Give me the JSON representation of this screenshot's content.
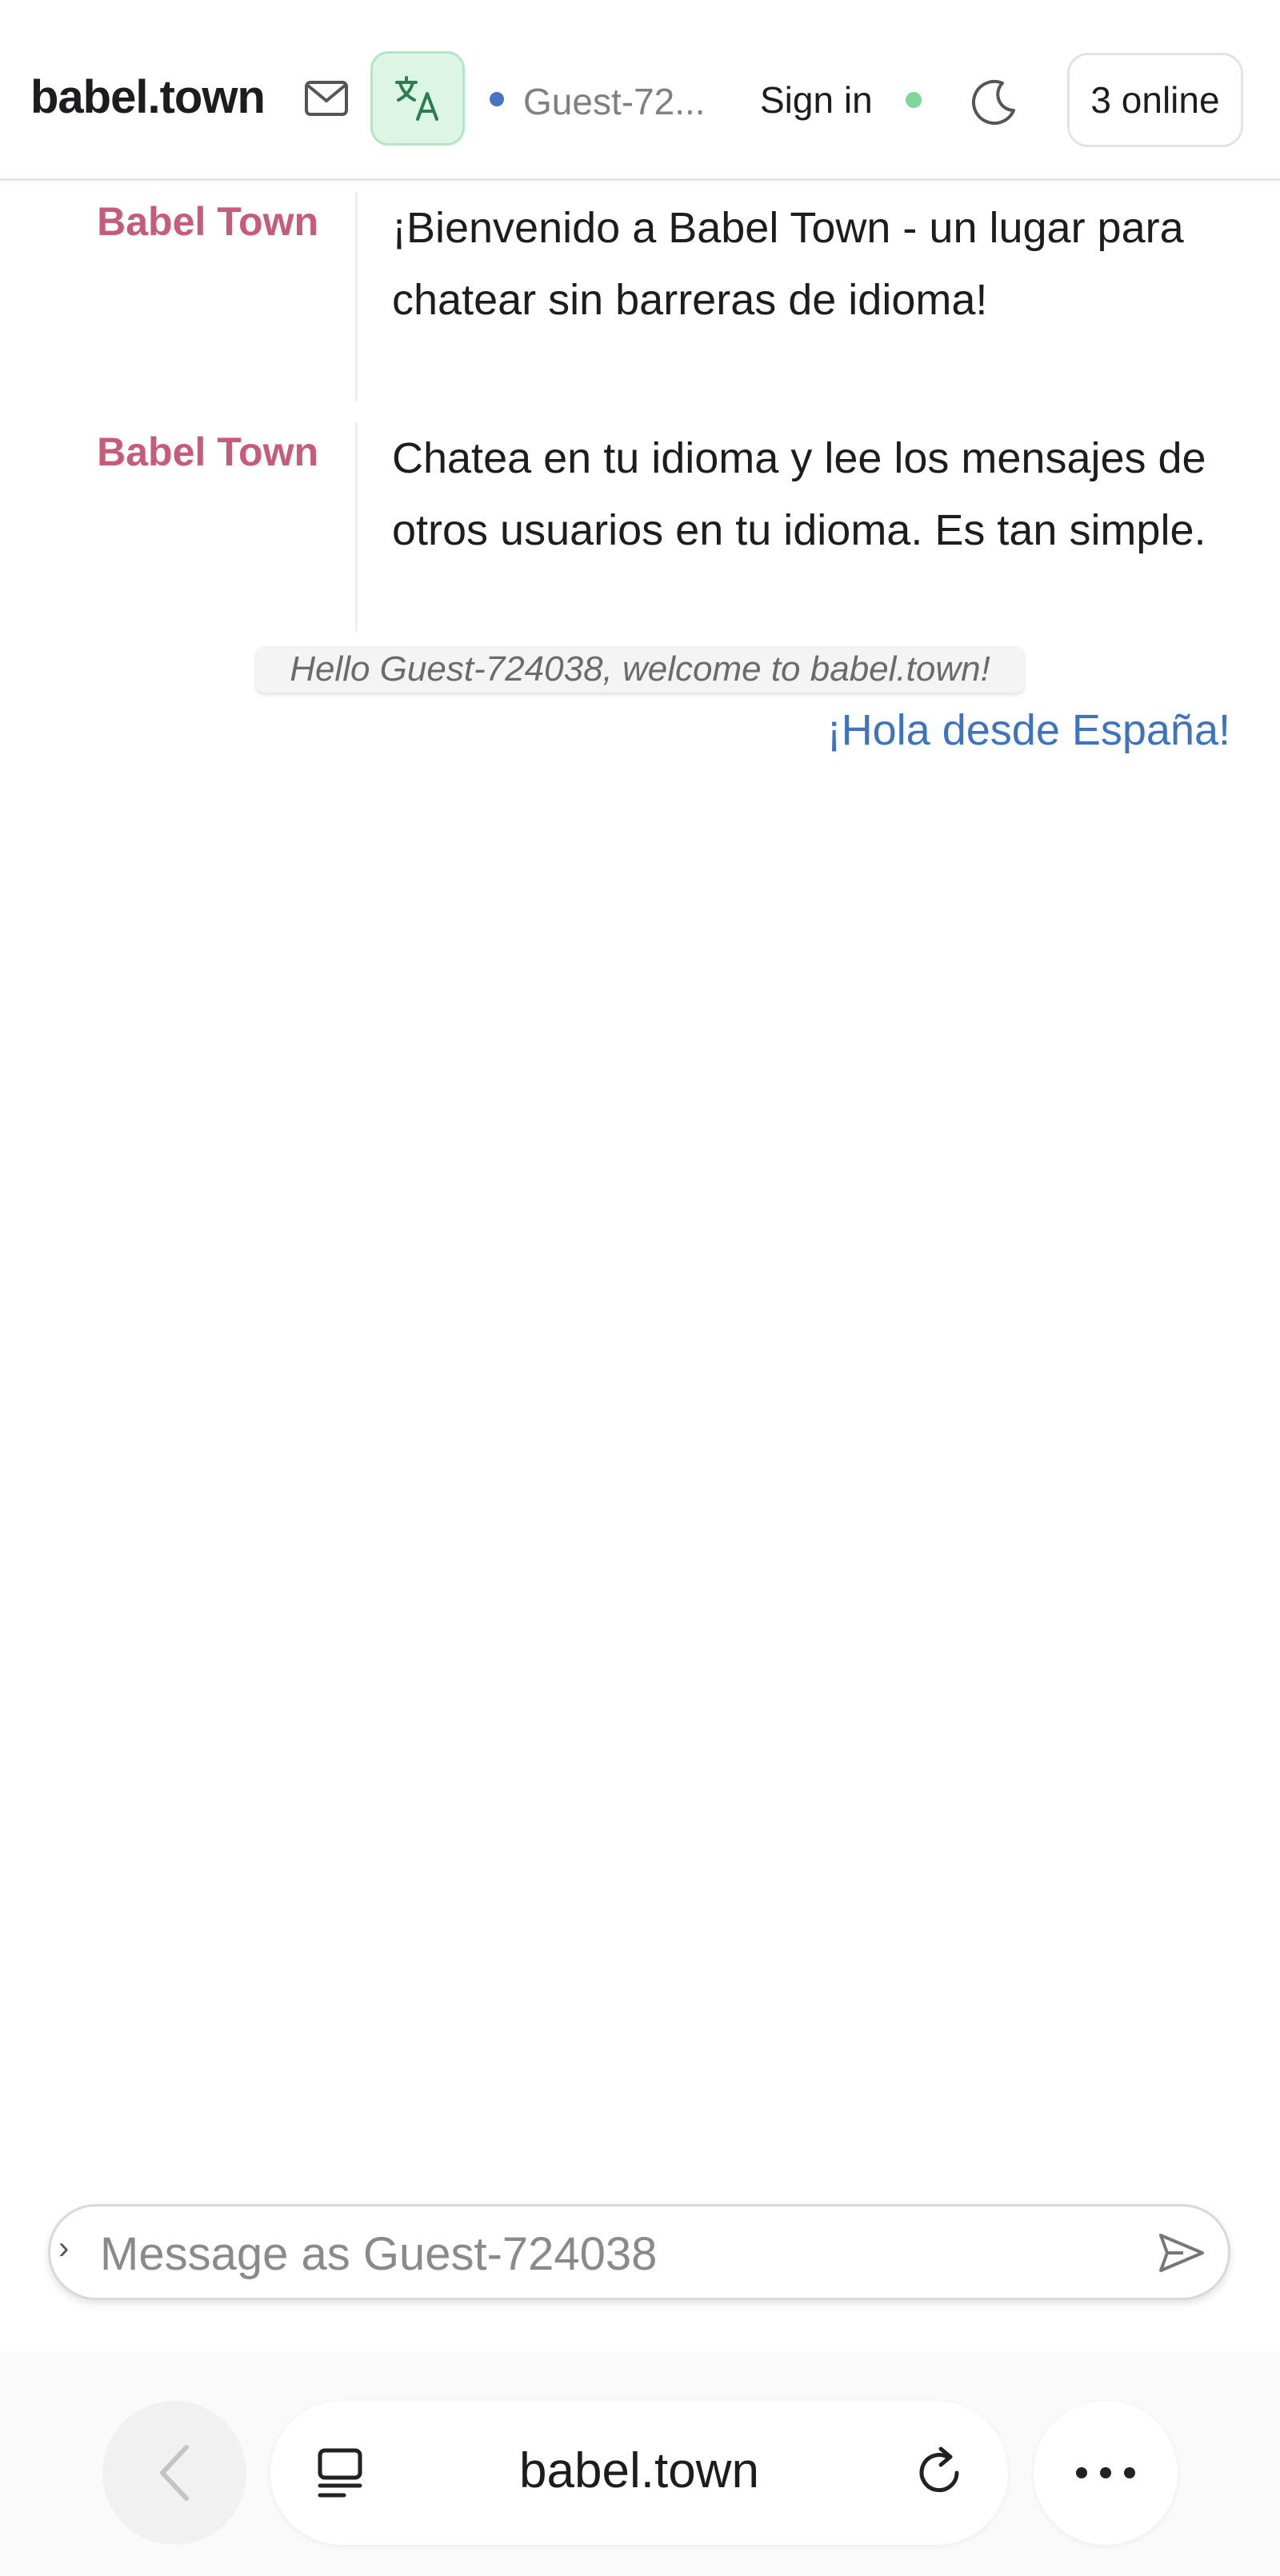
{
  "header": {
    "brand": "babel.town",
    "user_name": "Guest-72...",
    "sign_in": "Sign in",
    "online_count": "3 online",
    "icons": {
      "mail": "mail-icon",
      "translate": "translate-icon",
      "theme": "moon-icon"
    },
    "colors": {
      "user_dot": "#4a72c4",
      "online_dot": "#7fd79a",
      "translate_bg": "#dcf5e5"
    }
  },
  "messages": [
    {
      "sender": "Babel Town",
      "text": "¡Bienvenido a Babel Town - un lugar para chatear sin barreras de idioma!"
    },
    {
      "sender": "Babel Town",
      "text": "Chatea en tu idioma y lee los mensajes de otros usuarios en tu idioma. Es tan simple."
    }
  ],
  "system_note": "Hello Guest-724038, welcome to babel.town!",
  "own_message": "¡Hola desde España!",
  "composer": {
    "placeholder": "Message as Guest-724038",
    "value": "",
    "expand_glyph": "›"
  },
  "browser": {
    "url": "babel.town",
    "icons": {
      "back": "chevron-left-icon",
      "tabs": "tabs-icon",
      "reload": "reload-icon",
      "more": "more-icon"
    }
  },
  "colors": {
    "sender": "#c75b7a",
    "own_message": "#3e73bf"
  }
}
